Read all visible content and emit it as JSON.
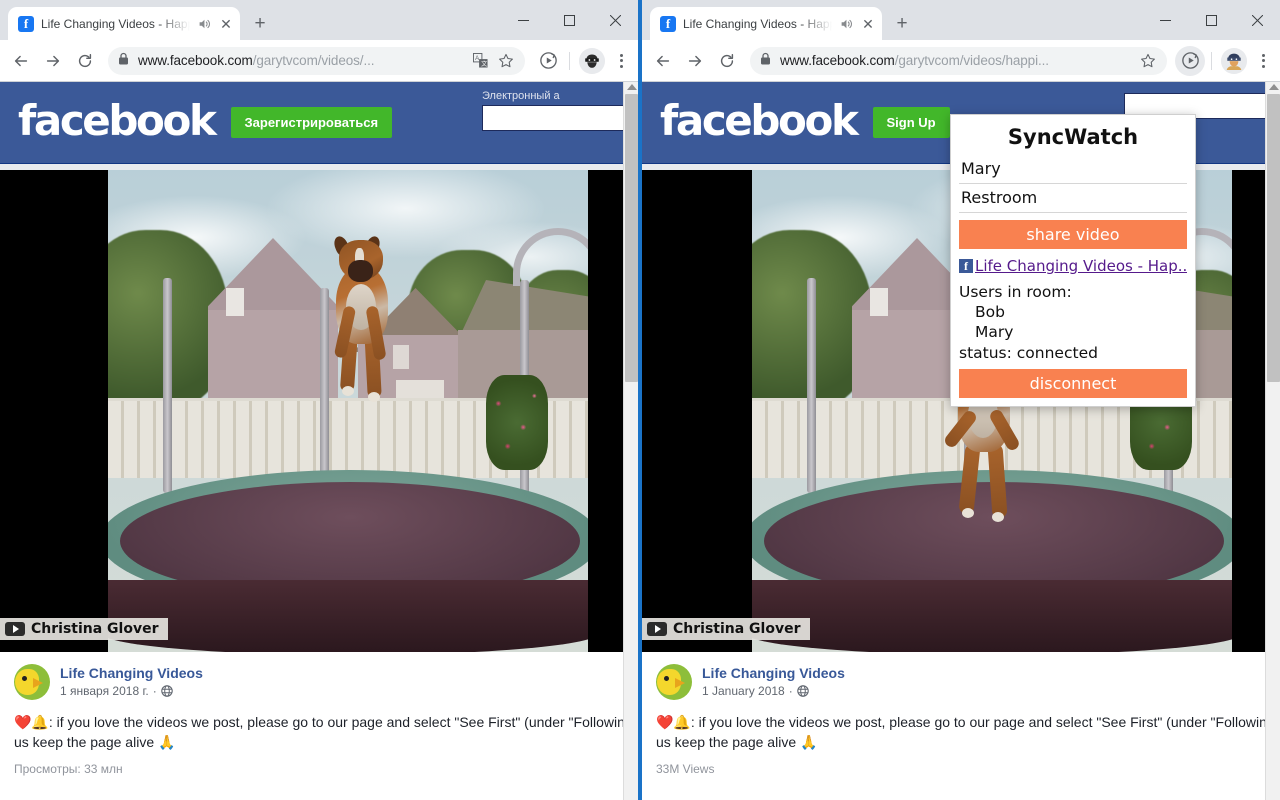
{
  "browser": {
    "tab": {
      "title": "Life Changing Videos - Happ",
      "favicon_icon": "facebook-favicon",
      "audio_icon": "speaker-icon",
      "close_icon": "close-icon"
    },
    "new_tab_label": "+",
    "window_controls": {
      "minimize": "minimize-icon",
      "maximize": "maximize-icon",
      "close": "close-icon"
    },
    "nav": {
      "back_icon": "back-arrow-icon",
      "forward_icon": "forward-arrow-icon",
      "reload_icon": "reload-icon"
    },
    "left_url": {
      "scheme": "https://",
      "domain": "www.facebook.com",
      "path": "/garytvcom/videos/...",
      "lock_icon": "lock-icon"
    },
    "right_url": {
      "scheme": "https://",
      "domain": "www.facebook.com",
      "path": "/garytvcom/videos/happi...",
      "lock_icon": "lock-icon"
    },
    "omnibox_icons": {
      "translate": "translate-icon",
      "bookmark": "star-icon"
    },
    "extensions": {
      "syncwatch": "syncwatch-extension-icon",
      "profile": "profile-avatar-icon",
      "menu": "three-dot-menu-icon"
    }
  },
  "facebook_left": {
    "logo": "facebook",
    "signup_label": "Зарегистрироваться",
    "email_label": "Электронный а",
    "email_value": ""
  },
  "facebook_right": {
    "logo": "facebook",
    "signup_label": "Sign Up",
    "email_label": "",
    "email_value": ""
  },
  "video": {
    "watermark": "Christina Glover",
    "watermark_icon": "youtube-play-icon",
    "scene": "dog jumping on a backyard trampoline"
  },
  "post_left": {
    "page_name": "Life Changing Videos",
    "date": "1 января 2018 г.",
    "privacy_icon": "globe-icon",
    "separator": "·",
    "body_line1": "❤️🔔: if you love the videos we post, please go to our page and select \"See First\" (under \"Followin",
    "body_line2": "us keep the page alive 🙏",
    "views": "Просмотры: 33 млн"
  },
  "post_right": {
    "page_name": "Life Changing Videos",
    "date": "1 January 2018",
    "privacy_icon": "globe-icon",
    "separator": "·",
    "body_line1": "❤️🔔: if you love the videos we post, please go to our page and select \"See First\" (under \"Followin",
    "body_line2": "us keep the page alive 🙏",
    "views": "33M Views"
  },
  "syncwatch": {
    "title": "SyncWatch",
    "username_value": "Mary",
    "room_value": "Restroom",
    "share_button": "share video",
    "shared_link_text": "Life Changing Videos - Hap...",
    "shared_link_icon": "facebook-icon",
    "users_label": "Users in room:",
    "users": [
      "Bob",
      "Mary"
    ],
    "status": "status: connected",
    "disconnect_button": "disconnect",
    "accent_color": "#f98150"
  }
}
